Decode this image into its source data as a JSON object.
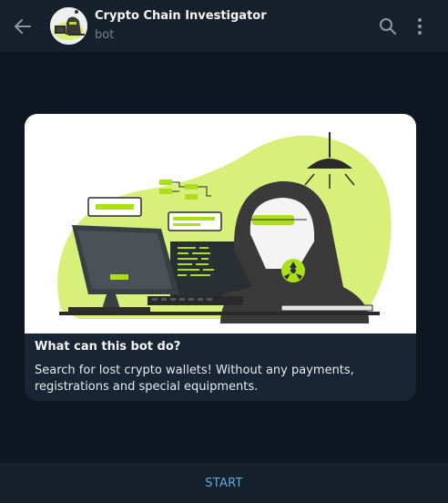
{
  "header": {
    "title": "Crypto Chain Investigator",
    "subtitle": "bot",
    "back_icon": "arrow-left-icon",
    "search_icon": "search-icon",
    "more_icon": "more-vertical-icon"
  },
  "intro_card": {
    "illustration": "hacker-at-computer-illustration",
    "title": "What can this bot do?",
    "description": "Search for lost crypto wallets! Without any payments, registrations and special equipments."
  },
  "footer": {
    "start_label": "START"
  },
  "colors": {
    "background": "#0e1621",
    "panel": "#17212b",
    "card": "#182533",
    "accent": "#5eaae4",
    "illustration_green": "#d8f07a",
    "illustration_neon": "#a9e01a"
  }
}
